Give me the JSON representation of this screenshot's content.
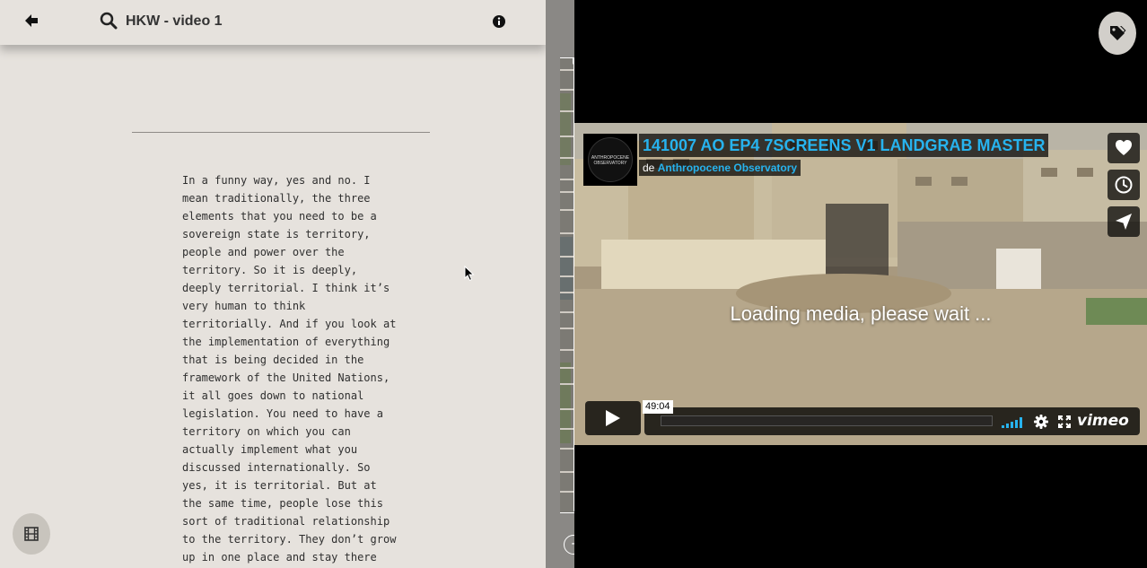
{
  "header": {
    "title": "HKW - video 1",
    "icons": {
      "back": "arrow-left-icon",
      "search": "search-icon",
      "info": "info-icon"
    }
  },
  "transcript": {
    "lines": [
      "In a funny way, yes and no. I",
      "mean traditionally, the three",
      "elements that you need to be a",
      "sovereign state is territory,",
      "people and power over the",
      "territory. So it is deeply,",
      "deeply territorial. I think it’s",
      "very human to think",
      "territorially. And if you look at",
      "the implementation of everything",
      "that is being decided in the",
      "framework of the United Nations,",
      "it all goes down to national",
      "legislation. You need to have a",
      "territory on which you can",
      "actually implement what you",
      "discussed internationally. So",
      "yes, it is territorial. But at",
      "the same time, people lose this",
      "sort of traditional relationship",
      "to the territory. They don’t grow",
      "up in one place and stay there"
    ]
  },
  "timeline": {
    "zoom_out_label": "-"
  },
  "player": {
    "title": "141007 AO EP4 7SCREENS V1 LANDGRAB MASTER",
    "byline_prefix": "de",
    "author": "Anthropocene Observatory",
    "channel_logo_text": "ANTHROPOCENE OBSERVATORY",
    "loading_text": "Loading media, please wait ...",
    "time_tooltip": "49:04",
    "brand": "vimeo",
    "side_buttons": [
      "heart-icon",
      "clock-icon",
      "send-icon"
    ],
    "accent_color": "#27b3ee"
  }
}
